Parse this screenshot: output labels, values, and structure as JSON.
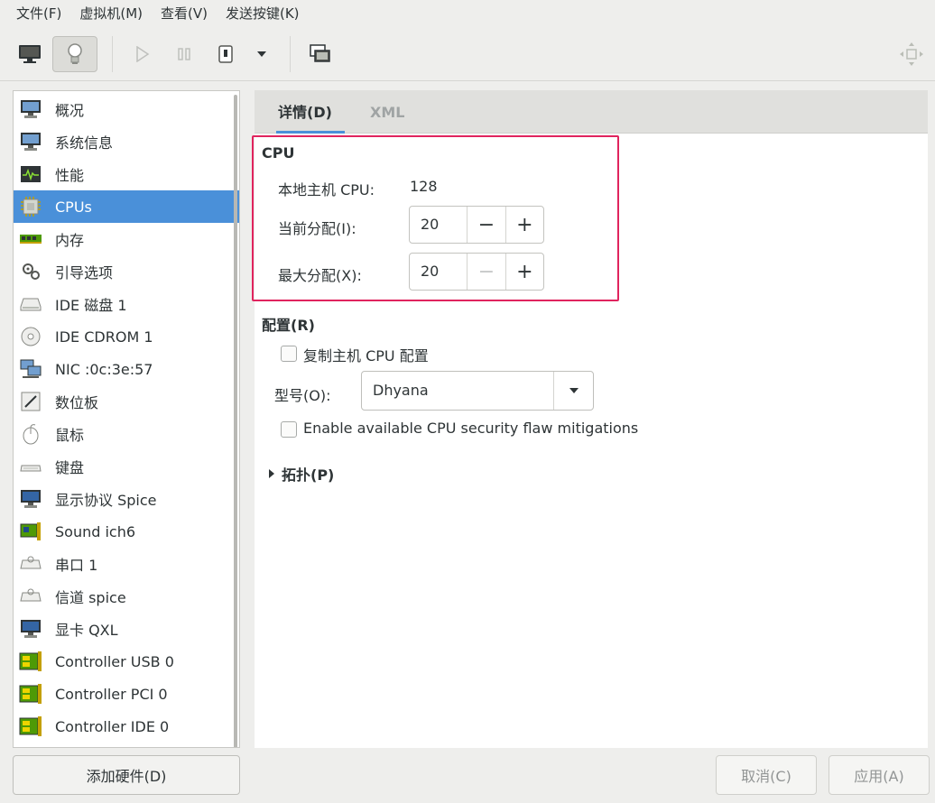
{
  "menubar": {
    "items": [
      "文件(F)",
      "虚拟机(M)",
      "查看(V)",
      "发送按键(K)"
    ]
  },
  "toolbar": {
    "icons": [
      "monitor-icon",
      "lightbulb-icon",
      "play-icon",
      "pause-icon",
      "power-icon",
      "dropdown-arrow-icon",
      "snapshot-icon",
      "resize-icon"
    ]
  },
  "sidebar": {
    "items": [
      {
        "label": "概况",
        "icon": "monitor-icon"
      },
      {
        "label": "系统信息",
        "icon": "monitor-icon"
      },
      {
        "label": "性能",
        "icon": "performance-icon"
      },
      {
        "label": "CPUs",
        "icon": "cpu-icon"
      },
      {
        "label": "内存",
        "icon": "memory-icon"
      },
      {
        "label": "引导选项",
        "icon": "gears-icon"
      },
      {
        "label": "IDE 磁盘 1",
        "icon": "disk-icon"
      },
      {
        "label": "IDE CDROM 1",
        "icon": "cdrom-icon"
      },
      {
        "label": "NIC :0c:3e:57",
        "icon": "network-icon"
      },
      {
        "label": "数位板",
        "icon": "tablet-icon"
      },
      {
        "label": "鼠标",
        "icon": "mouse-icon"
      },
      {
        "label": "键盘",
        "icon": "keyboard-icon"
      },
      {
        "label": "显示协议 Spice",
        "icon": "display-icon"
      },
      {
        "label": "Sound ich6",
        "icon": "sound-card-icon"
      },
      {
        "label": "串口 1",
        "icon": "serial-icon"
      },
      {
        "label": "信道 spice",
        "icon": "channel-icon"
      },
      {
        "label": "显卡 QXL",
        "icon": "video-card-icon"
      },
      {
        "label": "Controller USB 0",
        "icon": "controller-icon"
      },
      {
        "label": "Controller PCI 0",
        "icon": "controller-icon"
      },
      {
        "label": "Controller IDE 0",
        "icon": "controller-icon"
      }
    ],
    "selected_index": 3,
    "add_hardware_label": "添加硬件(D)"
  },
  "tabs": {
    "details_label": "详情(D)",
    "xml_label": "XML"
  },
  "cpu": {
    "section_title": "CPU",
    "host_cpu_label": "本地主机 CPU:",
    "host_cpu_value": "128",
    "current_alloc_label": "当前分配(I):",
    "current_alloc_value": "20",
    "max_alloc_label": "最大分配(X):",
    "max_alloc_value": "20",
    "minus": "−",
    "plus": "+"
  },
  "config": {
    "section_title": "配置(R)",
    "copy_host_label": "复制主机 CPU 配置",
    "copy_host_checked": false,
    "model_label": "型号(O):",
    "model_value": "Dhyana",
    "mitigations_label": "Enable available CPU security flaw mitigations",
    "mitigations_checked": false
  },
  "topology": {
    "label": "拓扑(P)"
  },
  "footer": {
    "cancel_label": "取消(C)",
    "apply_label": "应用(A)"
  },
  "colors": {
    "selection": "#4a90d9",
    "highlight_border": "#e0245e"
  }
}
